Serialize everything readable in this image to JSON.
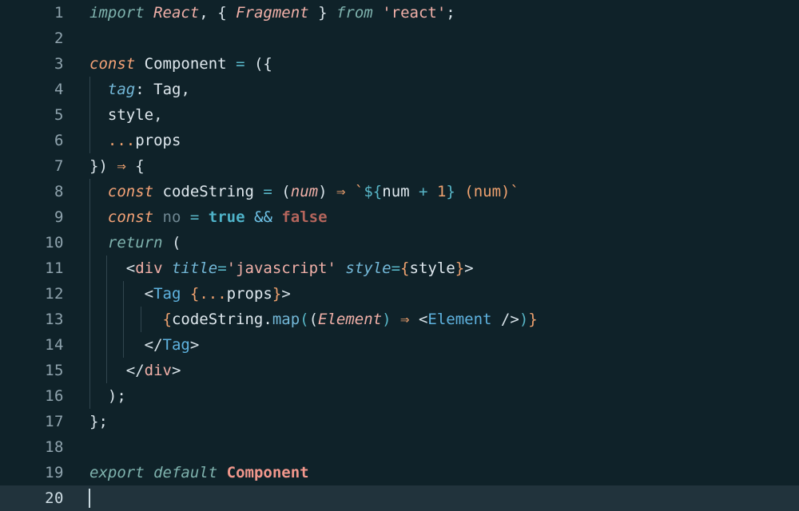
{
  "editor": {
    "language": "javascript",
    "theme": "dark-teal",
    "background_color": "#0f2229",
    "active_line_color": "#21333c",
    "line_number_color": "#8fa3ad",
    "active_line_number_color": "#cfdde4",
    "cursor_color": "#c9d9e0",
    "indent_guide_color": "#31454e",
    "total_lines": 20,
    "active_line": 20,
    "cursor_line": 20,
    "cursor_column": 1
  },
  "line_numbers": [
    "1",
    "2",
    "3",
    "4",
    "5",
    "6",
    "7",
    "8",
    "9",
    "10",
    "11",
    "12",
    "13",
    "14",
    "15",
    "16",
    "17",
    "18",
    "19",
    "20"
  ],
  "code": {
    "raw": "import React, { Fragment } from 'react';\n\nconst Component = ({\n  tag: Tag,\n  style,\n  ...props\n}) => {\n  const codeString = (num) => `${num + 1} (num)`\n  const no = true && false\n  return (\n    <div title='javascript' style={style}>\n      <Tag {...props}>\n        {codeString.map((Element) => <Element />)}\n      </Tag>\n    </div>\n  );\n};\n\nexport default Component\n",
    "lines": [
      {
        "n": 1,
        "indent": 0,
        "tokens": [
          {
            "t": "import",
            "c": "kw2"
          },
          {
            "t": " ",
            "c": "punc"
          },
          {
            "t": "React",
            "c": "type"
          },
          {
            "t": ", ",
            "c": "punc"
          },
          {
            "t": "{",
            "c": "punc"
          },
          {
            "t": " ",
            "c": "punc"
          },
          {
            "t": "Fragment",
            "c": "type"
          },
          {
            "t": " ",
            "c": "punc"
          },
          {
            "t": "}",
            "c": "punc"
          },
          {
            "t": " ",
            "c": "punc"
          },
          {
            "t": "from",
            "c": "kw2"
          },
          {
            "t": " ",
            "c": "punc"
          },
          {
            "t": "'react'",
            "c": "str"
          },
          {
            "t": ";",
            "c": "punc"
          }
        ]
      },
      {
        "n": 2,
        "indent": 0,
        "tokens": []
      },
      {
        "n": 3,
        "indent": 0,
        "tokens": [
          {
            "t": "const",
            "c": "kw"
          },
          {
            "t": " ",
            "c": "punc"
          },
          {
            "t": "Component",
            "c": "var"
          },
          {
            "t": " ",
            "c": "punc"
          },
          {
            "t": "=",
            "c": "op"
          },
          {
            "t": " ",
            "c": "punc"
          },
          {
            "t": "(",
            "c": "punc"
          },
          {
            "t": "{",
            "c": "punc"
          }
        ]
      },
      {
        "n": 4,
        "indent": 1,
        "tokens": [
          {
            "t": "  ",
            "c": "punc"
          },
          {
            "t": "tag",
            "c": "prop"
          },
          {
            "t": ":",
            "c": "punc"
          },
          {
            "t": " ",
            "c": "punc"
          },
          {
            "t": "Tag",
            "c": "var"
          },
          {
            "t": ",",
            "c": "punc"
          }
        ]
      },
      {
        "n": 5,
        "indent": 1,
        "tokens": [
          {
            "t": "  ",
            "c": "punc"
          },
          {
            "t": "style",
            "c": "var"
          },
          {
            "t": ",",
            "c": "punc"
          }
        ]
      },
      {
        "n": 6,
        "indent": 1,
        "tokens": [
          {
            "t": "  ",
            "c": "punc"
          },
          {
            "t": "...",
            "c": "brace"
          },
          {
            "t": "props",
            "c": "var"
          }
        ]
      },
      {
        "n": 7,
        "indent": 0,
        "tokens": [
          {
            "t": "}",
            "c": "punc"
          },
          {
            "t": ")",
            "c": "punc"
          },
          {
            "t": " ",
            "c": "punc"
          },
          {
            "t": "⇒",
            "c": "arrow"
          },
          {
            "t": " ",
            "c": "punc"
          },
          {
            "t": "{",
            "c": "punc"
          }
        ]
      },
      {
        "n": 8,
        "indent": 1,
        "tokens": [
          {
            "t": "  ",
            "c": "punc"
          },
          {
            "t": "const",
            "c": "kw"
          },
          {
            "t": " ",
            "c": "punc"
          },
          {
            "t": "codeString",
            "c": "var"
          },
          {
            "t": " ",
            "c": "punc"
          },
          {
            "t": "=",
            "c": "op"
          },
          {
            "t": " ",
            "c": "punc"
          },
          {
            "t": "(",
            "c": "punc"
          },
          {
            "t": "num",
            "c": "type"
          },
          {
            "t": ")",
            "c": "punc"
          },
          {
            "t": " ",
            "c": "punc"
          },
          {
            "t": "⇒",
            "c": "arrow"
          },
          {
            "t": " ",
            "c": "punc"
          },
          {
            "t": "`",
            "c": "num"
          },
          {
            "t": "$",
            "c": "op"
          },
          {
            "t": "{",
            "c": "op"
          },
          {
            "t": "num",
            "c": "var"
          },
          {
            "t": " ",
            "c": "punc"
          },
          {
            "t": "+",
            "c": "op"
          },
          {
            "t": " ",
            "c": "punc"
          },
          {
            "t": "1",
            "c": "num"
          },
          {
            "t": "}",
            "c": "op"
          },
          {
            "t": " ",
            "c": "punc"
          },
          {
            "t": "(num)",
            "c": "num"
          },
          {
            "t": "`",
            "c": "num"
          }
        ]
      },
      {
        "n": 9,
        "indent": 1,
        "tokens": [
          {
            "t": "  ",
            "c": "punc"
          },
          {
            "t": "const",
            "c": "kw"
          },
          {
            "t": " ",
            "c": "punc"
          },
          {
            "t": "no",
            "c": "dim"
          },
          {
            "t": " ",
            "c": "punc"
          },
          {
            "t": "=",
            "c": "op"
          },
          {
            "t": " ",
            "c": "punc"
          },
          {
            "t": "true",
            "c": "bool"
          },
          {
            "t": " ",
            "c": "punc"
          },
          {
            "t": "&&",
            "c": "amp"
          },
          {
            "t": " ",
            "c": "punc"
          },
          {
            "t": "false",
            "c": "false"
          }
        ]
      },
      {
        "n": 10,
        "indent": 1,
        "tokens": [
          {
            "t": "  ",
            "c": "punc"
          },
          {
            "t": "return",
            "c": "kw2"
          },
          {
            "t": " ",
            "c": "punc"
          },
          {
            "t": "(",
            "c": "punc"
          }
        ]
      },
      {
        "n": 11,
        "indent": 2,
        "tokens": [
          {
            "t": "    ",
            "c": "punc"
          },
          {
            "t": "<",
            "c": "punc"
          },
          {
            "t": "div",
            "c": "str"
          },
          {
            "t": " ",
            "c": "punc"
          },
          {
            "t": "title",
            "c": "prop"
          },
          {
            "t": "=",
            "c": "op"
          },
          {
            "t": "'javascript'",
            "c": "str"
          },
          {
            "t": " ",
            "c": "punc"
          },
          {
            "t": "style",
            "c": "prop"
          },
          {
            "t": "=",
            "c": "op"
          },
          {
            "t": "{",
            "c": "brace"
          },
          {
            "t": "style",
            "c": "var"
          },
          {
            "t": "}",
            "c": "brace"
          },
          {
            "t": ">",
            "c": "punc"
          }
        ]
      },
      {
        "n": 12,
        "indent": 3,
        "tokens": [
          {
            "t": "      ",
            "c": "punc"
          },
          {
            "t": "<",
            "c": "punc"
          },
          {
            "t": "Tag",
            "c": "cls"
          },
          {
            "t": " ",
            "c": "punc"
          },
          {
            "t": "{",
            "c": "brace"
          },
          {
            "t": "...",
            "c": "brace"
          },
          {
            "t": "props",
            "c": "var"
          },
          {
            "t": "}",
            "c": "brace"
          },
          {
            "t": ">",
            "c": "punc"
          }
        ]
      },
      {
        "n": 13,
        "indent": 4,
        "tokens": [
          {
            "t": "        ",
            "c": "punc"
          },
          {
            "t": "{",
            "c": "brace"
          },
          {
            "t": "codeString",
            "c": "var"
          },
          {
            "t": ".",
            "c": "punc"
          },
          {
            "t": "map",
            "c": "fn"
          },
          {
            "t": "(",
            "c": "op"
          },
          {
            "t": "(",
            "c": "punc"
          },
          {
            "t": "Element",
            "c": "type"
          },
          {
            "t": ")",
            "c": "op"
          },
          {
            "t": " ",
            "c": "punc"
          },
          {
            "t": "⇒",
            "c": "arrow"
          },
          {
            "t": " ",
            "c": "punc"
          },
          {
            "t": "<",
            "c": "punc"
          },
          {
            "t": "Element",
            "c": "cls"
          },
          {
            "t": " ",
            "c": "punc"
          },
          {
            "t": "/>",
            "c": "punc"
          },
          {
            "t": ")",
            "c": "op"
          },
          {
            "t": "}",
            "c": "brace"
          }
        ]
      },
      {
        "n": 14,
        "indent": 3,
        "tokens": [
          {
            "t": "      ",
            "c": "punc"
          },
          {
            "t": "</",
            "c": "punc"
          },
          {
            "t": "Tag",
            "c": "cls"
          },
          {
            "t": ">",
            "c": "punc"
          }
        ]
      },
      {
        "n": 15,
        "indent": 2,
        "tokens": [
          {
            "t": "    ",
            "c": "punc"
          },
          {
            "t": "</",
            "c": "punc"
          },
          {
            "t": "div",
            "c": "str"
          },
          {
            "t": ">",
            "c": "punc"
          }
        ]
      },
      {
        "n": 16,
        "indent": 1,
        "tokens": [
          {
            "t": "  ",
            "c": "punc"
          },
          {
            "t": ")",
            "c": "punc"
          },
          {
            "t": ";",
            "c": "punc"
          }
        ]
      },
      {
        "n": 17,
        "indent": 0,
        "tokens": [
          {
            "t": "}",
            "c": "punc"
          },
          {
            "t": ";",
            "c": "punc"
          }
        ]
      },
      {
        "n": 18,
        "indent": 0,
        "tokens": []
      },
      {
        "n": 19,
        "indent": 0,
        "tokens": [
          {
            "t": "export",
            "c": "kw2"
          },
          {
            "t": " ",
            "c": "punc"
          },
          {
            "t": "default",
            "c": "kw2"
          },
          {
            "t": " ",
            "c": "punc"
          },
          {
            "t": "Component",
            "c": "comp"
          }
        ]
      },
      {
        "n": 20,
        "indent": 0,
        "tokens": []
      }
    ]
  }
}
